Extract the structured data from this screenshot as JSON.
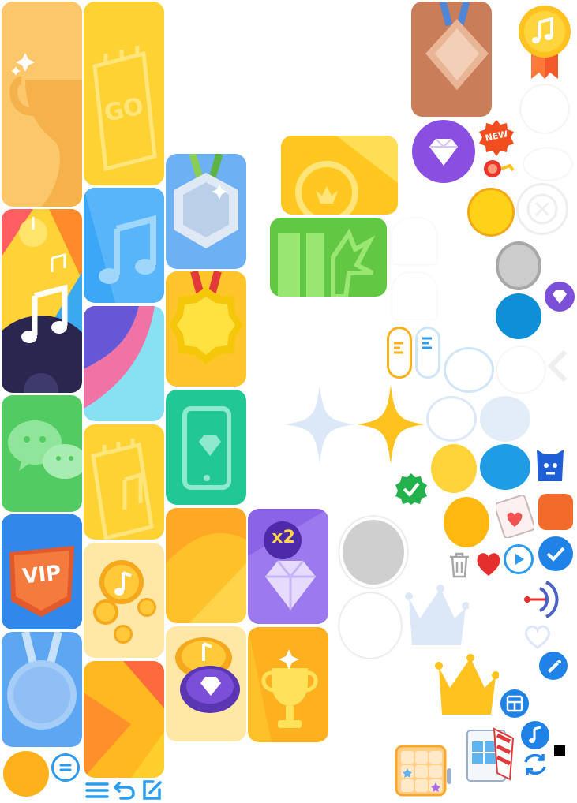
{
  "icons": {
    "trophy_tile": "trophy-icon",
    "go_tile": "go-card-icon",
    "music_tile": "music-note-icon",
    "wechat_tile": "wechat-icon",
    "vip_tile": "vip-badge-icon",
    "silver_medal": "silver-medal-icon",
    "gold_medal": "gold-medal-icon",
    "phone_diamond": "phone-diamond-icon",
    "diamond_x2": "diamond-x2-icon",
    "coins": "music-coins-icon",
    "coin_diamond": "coin-diamond-icon",
    "gold_trophy": "gold-trophy-icon",
    "bronze_medal": "bronze-medal-icon",
    "music_badge": "music-badge-icon",
    "crown": "crown-icon"
  },
  "labels": {
    "go": "GO",
    "vip": "VIP",
    "x2": "x2",
    "new": "NEW"
  },
  "colors": {
    "orange": "#ffb11b",
    "yellow": "#ffcf2e",
    "blue": "#0f8fd6",
    "green": "#34b648",
    "purple": "#7c4fd8",
    "teal": "#22c796",
    "red": "#f05151"
  }
}
